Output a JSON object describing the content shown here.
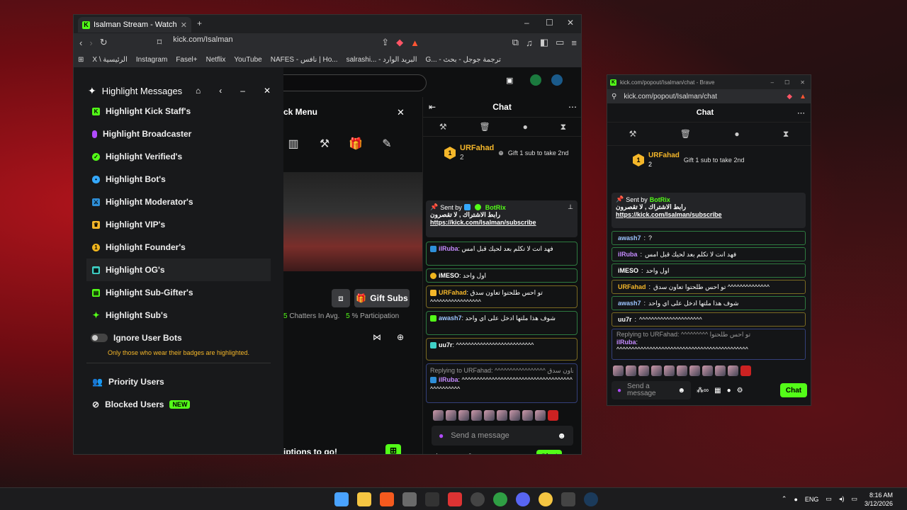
{
  "browser": {
    "tab_title": "Isalman Stream - Watch Live",
    "url": "kick.com/Isalman",
    "bookmarks": [
      "X \\ الرئيسية",
      "Instagram",
      "Fasel+",
      "Netflix",
      "YouTube",
      "NAFES - نافس | Ho...",
      "salrashi... - البريد الوارد",
      "G... - ترجمة جوجل - بحث"
    ]
  },
  "highlight_panel": {
    "title": "Highlight Messages",
    "items": [
      {
        "label": "Highlight Kick Staff's",
        "icon": "kick-staff-icon",
        "color": "#53fc18"
      },
      {
        "label": "Highlight Broadcaster",
        "icon": "mic-icon",
        "color": "#b14bff"
      },
      {
        "label": "Highlight Verified's",
        "icon": "verified-icon",
        "color": "#53fc18"
      },
      {
        "label": "Highlight Bot's",
        "icon": "bot-icon",
        "color": "#35a9ff"
      },
      {
        "label": "Highlight Moderator's",
        "icon": "sword-icon",
        "color": "#2e8fd8"
      },
      {
        "label": "Highlight VIP's",
        "icon": "crown-icon",
        "color": "#f5b72a"
      },
      {
        "label": "Highlight Founder's",
        "icon": "founder-icon",
        "color": "#f0b51e"
      },
      {
        "label": "Highlight OG's",
        "icon": "og-icon",
        "color": "#3fd1c7"
      },
      {
        "label": "Highlight Sub-Gifter's",
        "icon": "gift-icon",
        "color": "#53fc18"
      },
      {
        "label": "Highlight Sub's",
        "icon": "star-icon",
        "color": "#53fc18"
      }
    ],
    "toggle_label": "Ignore User Bots",
    "note": "Only those who wear their badges are highlighted.",
    "priority_label": "Priority Users",
    "blocked_label": "Blocked Users",
    "new_badge": "NEW"
  },
  "quick_menu": {
    "title": "ck Menu",
    "gift_subs": "Gift Subs",
    "chatters_prefix": "5",
    "chatters": "Chatters In Avg.",
    "participation_num": "5",
    "participation": "% Participation",
    "bottom_text": "iptions to go!"
  },
  "chat": {
    "header": "Chat",
    "top_gifter": "URFahad",
    "gifter_count": "2",
    "gift_prompt": "Gift 1 sub to take 2nd",
    "pinned_by": "Sent by",
    "pinned_user": "BotRix",
    "pinned_text": "رابط الاشتراك , لا تقصرون",
    "pinned_link": "https://kick.com/Isalman/subscribe",
    "messages": [
      {
        "user": "ilRuba",
        "text": "فهد انت لا تكلم بعد لحيك قبل امس",
        "color": "#c58bff",
        "border": "#3a8a4a"
      },
      {
        "user": "iMESO",
        "text": "اول واحد",
        "color": "#fff",
        "border": "#3a8a4a"
      },
      {
        "user": "URFahad",
        "text": "تو احس طلحتوا تعاون سدق ^^^^^^^^^^^^^^^^^",
        "color": "#f5b72a",
        "border": "#8a7a2a"
      },
      {
        "user": "awash7",
        "text": "شوف هذا ملتها ادخل على اي واحد",
        "color": "#9cc4ff",
        "border": "#3a8a4a"
      },
      {
        "user": "uu7r",
        "text": "^^^^^^^^^^^^^^^^^^^^^^^^^^",
        "color": "#fff",
        "border": "#8a7a2a"
      },
      {
        "user": "ilRuba",
        "text": "^^^^^^^^^^^^^^^^^^^^^^^^^^^^^^^^^^^^^^^^^^^^^^^",
        "color": "#c58bff",
        "border": "#3a4a8a",
        "reply": "Replying to URFahad: ^^^^^^^^^^^^^^^^^ تو احس طلحتوا تعاون سدق"
      }
    ],
    "input_placeholder": "Send a message",
    "chat_button": "Chat",
    "points": "0"
  },
  "popout": {
    "title": "kick.com/popout/Isalman/chat - Brave",
    "url": "kick.com/popout/Isalman/chat",
    "header": "Chat",
    "messages": [
      {
        "user": "awash7",
        "text": "?",
        "color": "#9cc4ff"
      },
      {
        "user": "ilRuba",
        "text": "فهد انت لا تكلم بعد لحيك قبل امس",
        "color": "#c58bff"
      },
      {
        "user": "iMESO",
        "text": "اول واحد",
        "color": "#fff"
      },
      {
        "user": "URFahad",
        "text": "تو احس طلحتوا تعاون سدق ^^^^^^^^^^^^^^",
        "color": "#f5b72a"
      },
      {
        "user": "awash7",
        "text": "شوف هذا ملتها ادخل على اي واحد",
        "color": "#9cc4ff"
      },
      {
        "user": "uu7r",
        "text": "^^^^^^^^^^^^^^^^^^^^^",
        "color": "#fff"
      }
    ],
    "reply": "Replying to URFahad: ^^^^^^^^^ تو احس طلحتوا",
    "reply_user": "ilRuba",
    "reply_text": "^^^^^^^^^^^^^^^^^^^^^^^^^^^^^^^^^^^^^^^^^^^^"
  },
  "taskbar": {
    "lang": "ENG",
    "time": "8:16 AM",
    "date": "3/12/2026"
  }
}
